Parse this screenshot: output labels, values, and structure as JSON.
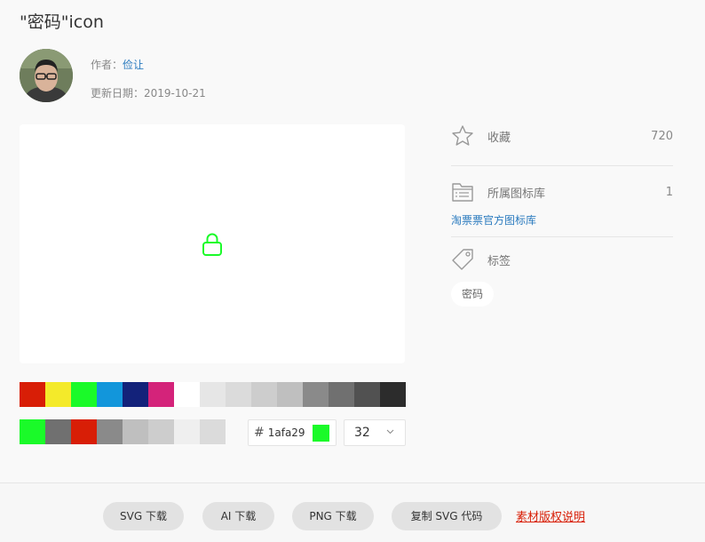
{
  "page": {
    "title": "\"密码\"icon"
  },
  "author": {
    "label": "作者：",
    "name": "俭让",
    "date_label": "更新日期：",
    "date": "2019-10-21"
  },
  "preview": {
    "icon": "lock-icon",
    "color": "#1afa29"
  },
  "palette": {
    "colors": [
      "#d81e06",
      "#f4ea2a",
      "#1afa29",
      "#1296db",
      "#13227a",
      "#d4237a",
      "#ffffff",
      "#e6e6e6",
      "#dbdbdb",
      "#cdcdcd",
      "#bfbfbf",
      "#8a8a8a",
      "#707070",
      "#515151",
      "#2c2c2c"
    ]
  },
  "recent": {
    "colors": [
      "#1afa29",
      "#707070",
      "#d81e06",
      "#8a8a8a",
      "#bfbfbf",
      "#cdcdcd",
      "#efefef",
      "#dbdbdb"
    ]
  },
  "controls": {
    "hash": "#",
    "hex_value": "1afa29",
    "current_color": "#1afa29",
    "size_value": "32"
  },
  "sidebar": {
    "favorite_label": "收藏",
    "favorite_count": "720",
    "library_label": "所属图标库",
    "library_count": "1",
    "library_name": "淘票票官方图标库",
    "tags_label": "标签",
    "tags": [
      "密码"
    ]
  },
  "footer": {
    "svg_download": "SVG 下载",
    "ai_download": "AI 下载",
    "png_download": "PNG 下载",
    "copy_svg": "复制 SVG 代码",
    "license": "素材版权说明"
  }
}
